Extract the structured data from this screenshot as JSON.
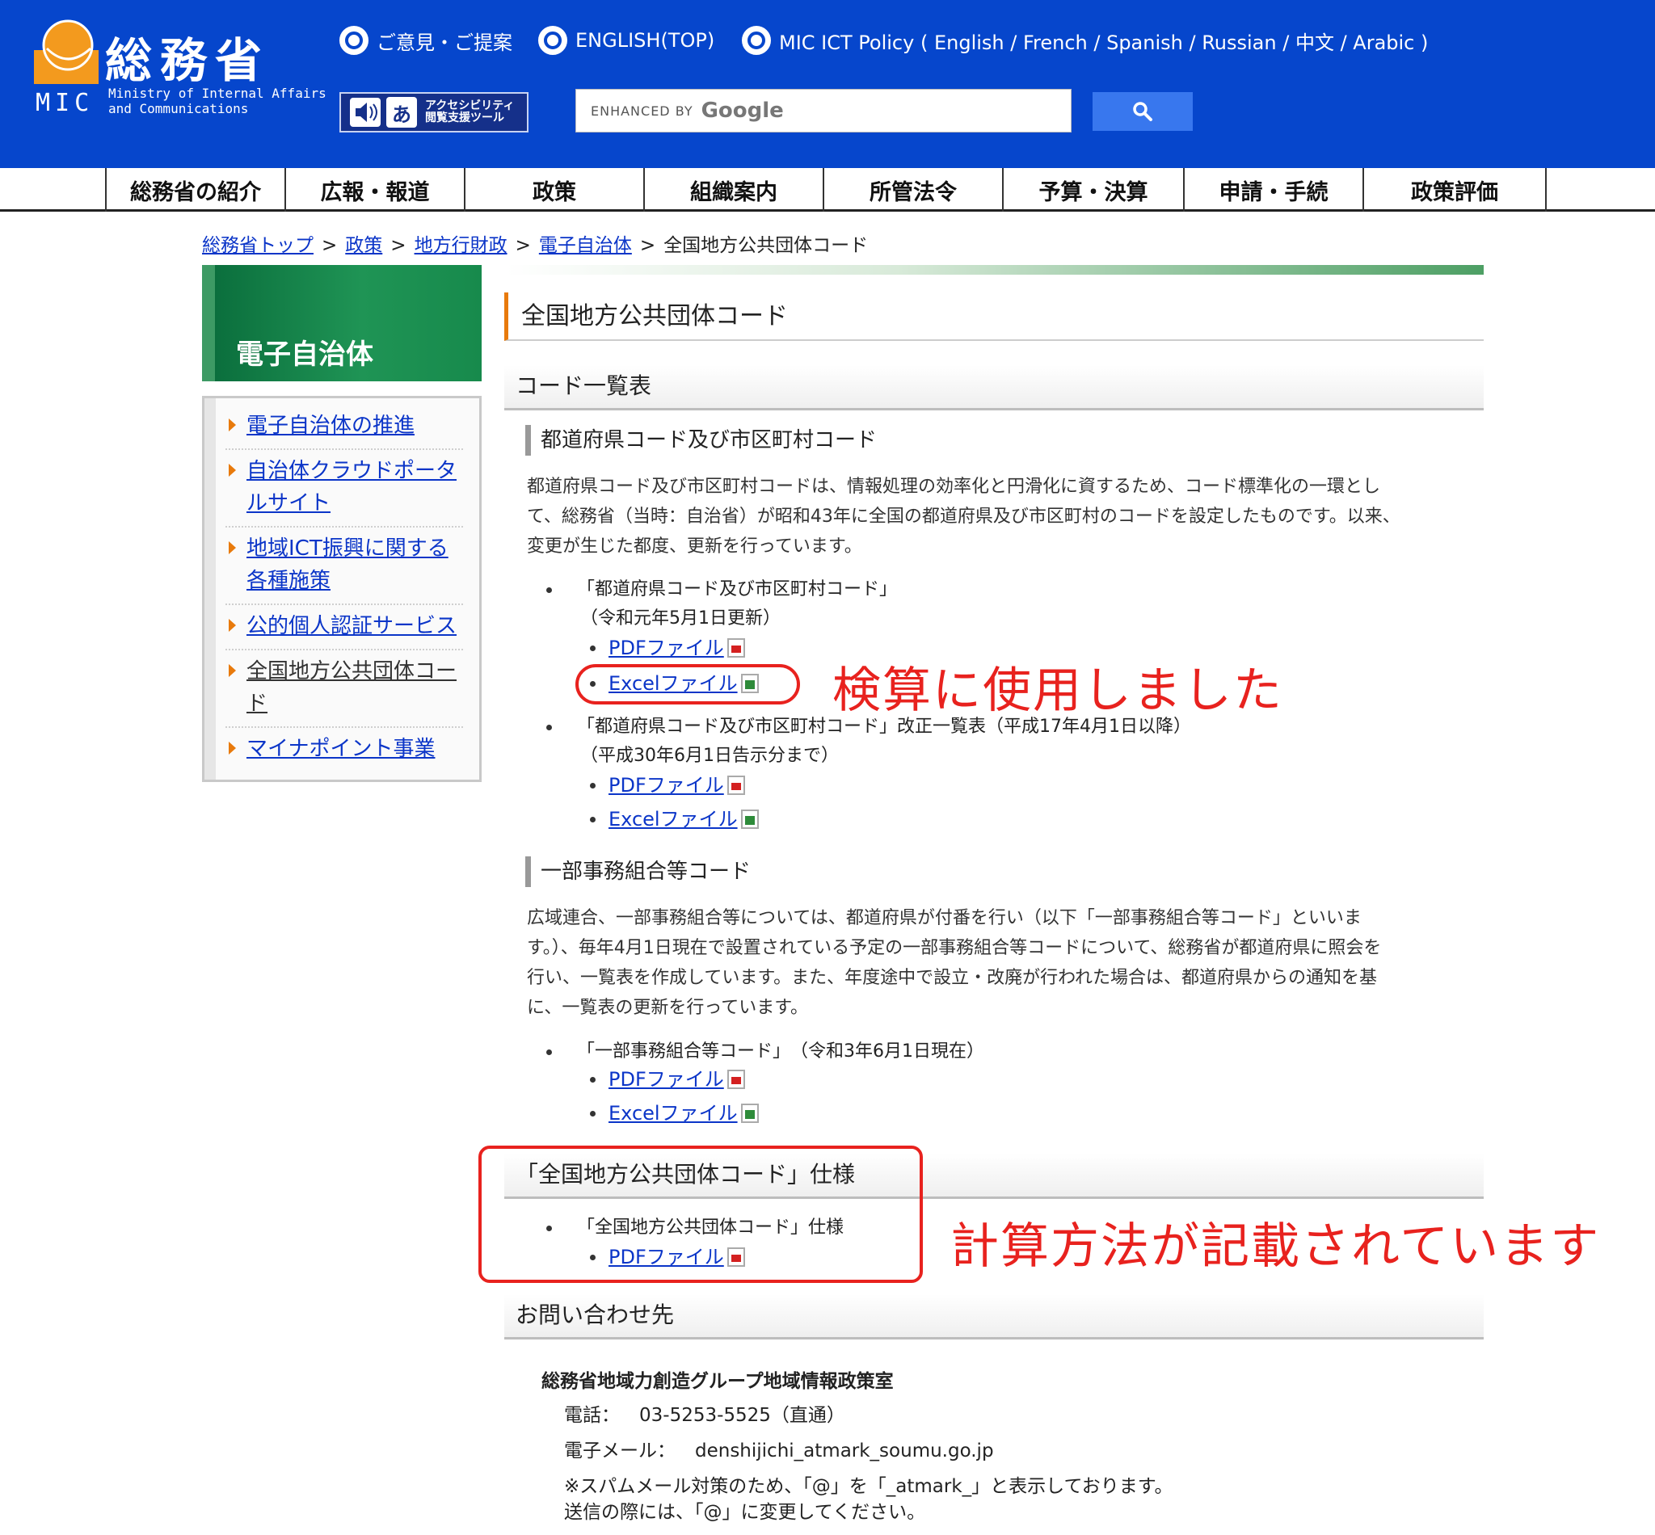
{
  "header": {
    "logo_ja": "総務省",
    "logo_mic": "MIC",
    "logo_en_line1": "Ministry of Internal Affairs",
    "logo_en_line2": "and Communications",
    "links": [
      "ご意見・ご提案",
      "ENGLISH(TOP)",
      "MIC ICT Policy ( English / French / Spanish / Russian / 中文 / Arabic )"
    ],
    "accessibility": {
      "icon_text": "あ",
      "label_line1": "アクセシビリティ",
      "label_line2": "閲覧支援ツール"
    },
    "search": {
      "enhanced_by": "ENHANCED BY",
      "google": "Google",
      "value": ""
    },
    "colors": {
      "header_bg": "#0646cc",
      "search_button": "#3877ee",
      "logo_orange": "#f39a1e"
    }
  },
  "nav": [
    "総務省の紹介",
    "広報・報道",
    "政策",
    "組織案内",
    "所管法令",
    "予算・決算",
    "申請・手続",
    "政策評価"
  ],
  "breadcrumb": {
    "links": [
      "総務省トップ",
      "政策",
      "地方行財政",
      "電子自治体"
    ],
    "separator": ">",
    "current": "全国地方公共団体コード"
  },
  "sidebar": {
    "title": "電子自治体",
    "items": [
      {
        "label": "電子自治体の推進"
      },
      {
        "label": "自治体クラウドポータルサイト"
      },
      {
        "label": "地域ICT振興に関する各種施策"
      },
      {
        "label": "公的個人認証サービス"
      },
      {
        "label": "全国地方公共団体コード"
      },
      {
        "label": "マイナポイント事業"
      }
    ]
  },
  "main": {
    "page_title": "全国地方公共団体コード",
    "section1": {
      "heading": "コード一覧表",
      "sub1": {
        "heading": "都道府県コード及び市区町村コード",
        "para_lines": [
          "都道府県コード及び市区町村コードは、情報処理の効率化と円滑化に資するため、コード標準化の一環とし",
          "て、総務省（当時：自治省）が昭和43年に全国の都道府県及び市区町村のコードを設定したものです。以来、",
          "変更が生じた都度、更新を行っています。"
        ],
        "item1_title": "「都道府県コード及び市区町村コード」",
        "item1_sub": "（令和元年5月1日更新）",
        "item2_title": "「都道府県コード及び市区町村コード」改正一覧表（平成17年4月1日以降）",
        "item2_sub": "（平成30年6月1日告示分まで）"
      },
      "sub2": {
        "heading": "一部事務組合等コード",
        "para_lines": [
          "広域連合、一部事務組合等については、都道府県が付番を行い（以下「一部事務組合等コード」といいま",
          "す。）、毎年4月1日現在で設置されている予定の一部事務組合等コードについて、総務省が都道府県に照会を",
          "行い、一覧表を作成しています。また、年度途中で設立・改廃が行われた場合は、都道府県からの通知を基",
          "に、一覧表の更新を行っています。"
        ],
        "item1_title": "「一部事務組合等コード」　（令和3年6月1日現在）"
      }
    },
    "section2": {
      "heading": "「全国地方公共団体コード」仕様",
      "item1_title": "「全国地方公共団体コード」仕様"
    },
    "file_links": {
      "pdf": "PDFファイル",
      "excel": "Excelファイル"
    },
    "contact": {
      "heading": "お問い合わせ先",
      "org": "総務省地域力創造グループ地域情報政策室",
      "tel_label": "電話：",
      "tel": "03-5253-5525（直通）",
      "mail_label": "電子メール：",
      "mail": "denshijichi_atmark_soumu.go.jp",
      "note1": "※スパムメール対策のため、「@」を「_atmark_」と表示しております。",
      "note2": "送信の際には、「@」に変更してください。"
    }
  },
  "annotations": {
    "note1": "検算に使用しました",
    "note2": "計算方法が記載されています",
    "color": "#e8221e"
  }
}
